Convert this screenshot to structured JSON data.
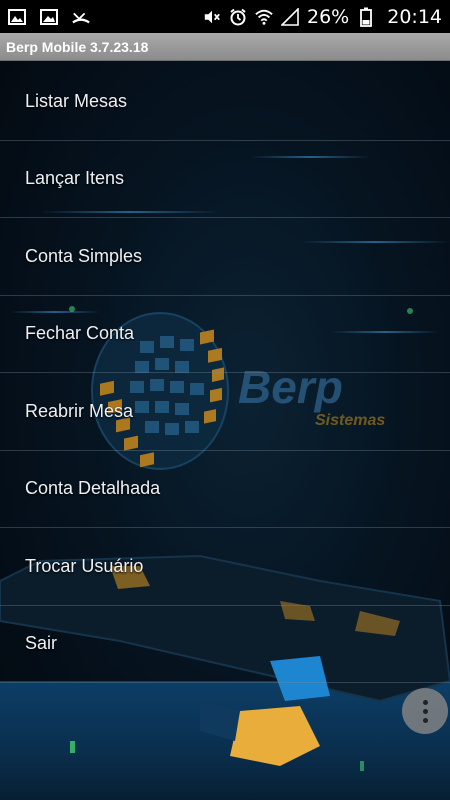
{
  "status_bar": {
    "battery_percent": "26%",
    "time": "20:14",
    "left_icons": [
      "gallery-icon",
      "image-icon",
      "missed-call-icon"
    ],
    "right_icons": [
      "mute-icon",
      "alarm-icon",
      "wifi-icon",
      "signal-icon",
      "battery-icon"
    ]
  },
  "app": {
    "title": "Berp Mobile 3.7.23.18"
  },
  "logo": {
    "brand": "Berp",
    "tagline": "Sistemas"
  },
  "menu": {
    "items": [
      {
        "label": "Listar Mesas"
      },
      {
        "label": "Lançar Itens"
      },
      {
        "label": "Conta Simples"
      },
      {
        "label": "Fechar Conta"
      },
      {
        "label": "Reabrir Mesa"
      },
      {
        "label": "Conta Detalhada"
      },
      {
        "label": "Trocar Usuário"
      },
      {
        "label": "Sair"
      }
    ]
  },
  "colors": {
    "accent_orange": "#f0a020",
    "accent_blue": "#1b8ad6",
    "background": "#061421"
  }
}
